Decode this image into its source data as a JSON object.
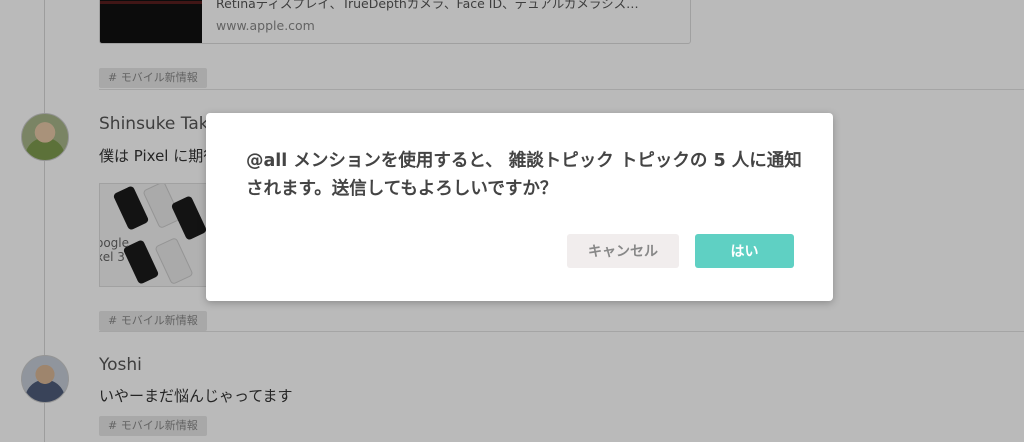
{
  "feed": {
    "link_preview": {
      "description": "Retinaディスプレイ、TrueDepthカメラ、Face ID、デュアルカメラシス…",
      "url": "www.apple.com"
    },
    "topic_tags": [
      "# モバイル新情報",
      "# モバイル新情報",
      "# モバイル新情報"
    ],
    "posts": [
      {
        "author": "Shinsuke Tak",
        "message": "僕は Pixel に期待",
        "image_text": "oogle\nxel 3"
      },
      {
        "author": "Yoshi",
        "message": "いやーまだ悩んじゃってます"
      }
    ]
  },
  "dialog": {
    "message": "@all メンションを使用すると、 雑談トピック トピックの 5 人に通知されます。送信してもよろしいですか？",
    "cancel_label": "キャンセル",
    "confirm_label": "はい"
  },
  "colors": {
    "confirm_button": "#5fd0c3",
    "cancel_button": "#f1eded",
    "overlay": "rgba(0,0,0,0.27)"
  }
}
